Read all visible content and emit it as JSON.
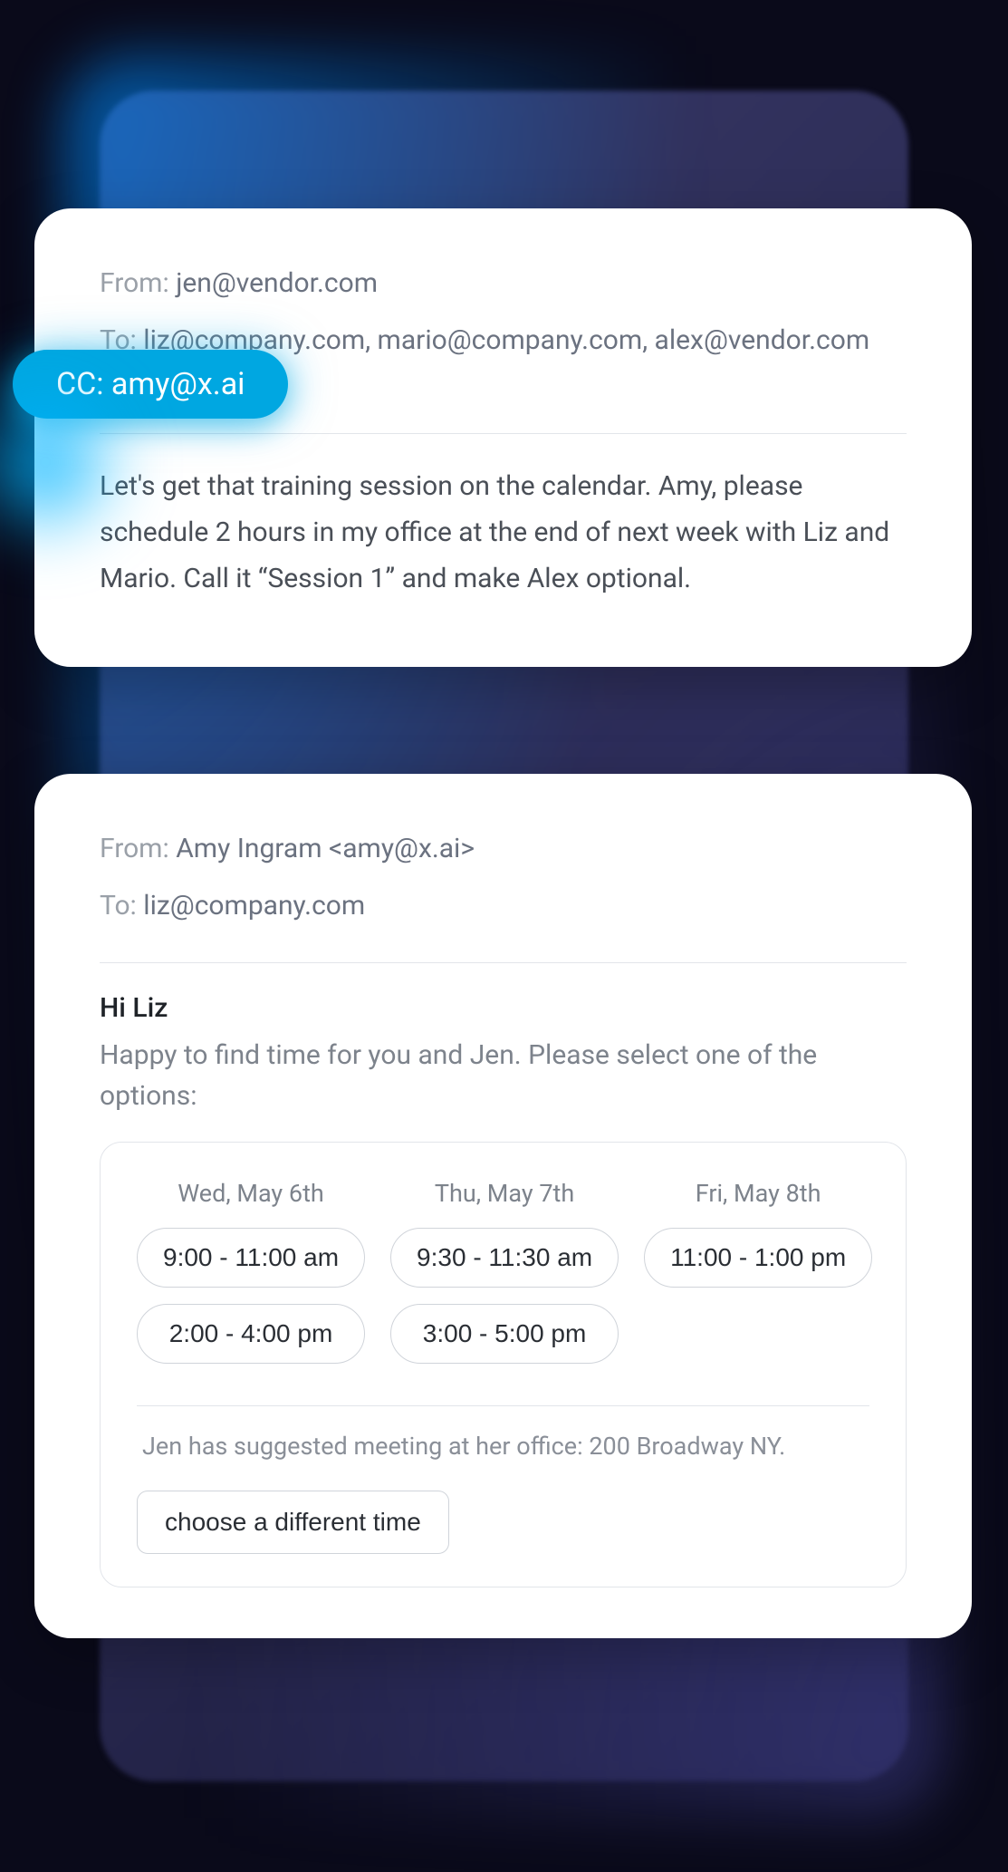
{
  "email1": {
    "from_label": "From: ",
    "from_value": "jen@vendor.com",
    "to_label": "To: ",
    "to_value": "liz@company.com, mario@company.com, alex@vendor.com",
    "cc_text": "CC: amy@x.ai",
    "body": "Let's get that training session on the calendar. Amy, please schedule 2 hours in my office at the end of next week with Liz and Mario. Call it “Session 1” and make Alex optional."
  },
  "email2": {
    "from_label": "From: ",
    "from_value": "Amy Ingram <amy@x.ai>",
    "to_label": "To: ",
    "to_value": "liz@company.com",
    "greeting": "Hi Liz",
    "intro": "Happy to find time for you and Jen. Please select one of the options:",
    "dates": [
      {
        "label": "Wed, May 6th",
        "slots": [
          "9:00 - 11:00 am",
          "2:00 - 4:00 pm"
        ]
      },
      {
        "label": "Thu, May 7th",
        "slots": [
          "9:30 - 11:30 am",
          "3:00 - 5:00 pm"
        ]
      },
      {
        "label": "Fri, May 8th",
        "slots": [
          "11:00 - 1:00 pm"
        ]
      }
    ],
    "location_note": "Jen has suggested meeting at her office: 200 Broadway NY.",
    "alt_button": "choose a different time"
  }
}
